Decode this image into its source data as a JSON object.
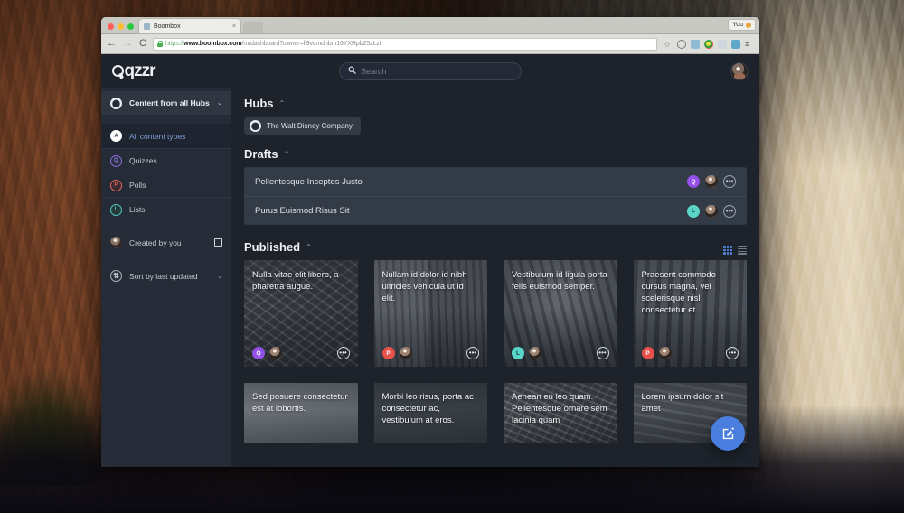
{
  "browser": {
    "tab_title": "Boombox",
    "tab_close": "×",
    "profile_label": "You",
    "url_scheme": "https://",
    "url_domain": "www.boombox.com",
    "url_path": "/m/dashboard?owner=fi9vcmdhbm16YXRpb25zLzI",
    "back_icon": "←",
    "forward_icon": "→",
    "reload_icon": "C",
    "star_icon": "☆",
    "menu_icon": "≡"
  },
  "app": {
    "logo": "qzzr",
    "search": {
      "placeholder": "Search",
      "value": ""
    }
  },
  "sidebar": {
    "header": {
      "label": "Content from all Hubs",
      "chevron": "⌄"
    },
    "items": [
      {
        "label": "All content types",
        "badge": "A",
        "badge_class": "all",
        "active": true
      },
      {
        "label": "Quizzes",
        "badge": "Q",
        "badge_class": "quiz",
        "active": false
      },
      {
        "label": "Polls",
        "badge": "P",
        "badge_class": "poll",
        "active": false
      },
      {
        "label": "Lists",
        "badge": "L",
        "badge_class": "list",
        "active": false
      }
    ],
    "created_by_you": {
      "label": "Created by you",
      "checked": false
    },
    "sort": {
      "label": "Sort by last updated",
      "chevron": "⌄",
      "icon": "⇅"
    }
  },
  "main": {
    "hubs": {
      "title": "Hubs",
      "caret": "⌃",
      "chip": {
        "label": "The Walt Disney Company",
        "icon": "⬤"
      }
    },
    "drafts": {
      "title": "Drafts",
      "caret": "⌃",
      "rows": [
        {
          "title": "Pellentesque Inceptos Justo",
          "type": "Q",
          "type_class": "quiz",
          "more": "•••"
        },
        {
          "title": "Purus Euismod Risus Sit",
          "type": "L",
          "type_class": "list",
          "more": "•••"
        }
      ]
    },
    "published": {
      "title": "Published",
      "caret": "⌃",
      "view_grid": "grid-view",
      "view_list": "list-view",
      "cards": [
        {
          "title": "Nulla vitae elit libero, a pharetra augue.",
          "type": "Q",
          "type_class": "quiz",
          "photo": "ph1",
          "more": "•••"
        },
        {
          "title": "Nullam id dolor id nibh ultricies vehicula ut id elit.",
          "type": "P",
          "type_class": "poll",
          "photo": "ph2",
          "more": "•••"
        },
        {
          "title": "Vestibulum id ligula porta felis euismod semper.",
          "type": "L",
          "type_class": "list",
          "photo": "ph3",
          "more": "•••"
        },
        {
          "title": "Praesent commodo cursus magna, vel scelerisque nisl consectetur et.",
          "type": "P",
          "type_class": "poll",
          "photo": "ph4",
          "more": "•••"
        }
      ],
      "cards_row2": [
        {
          "title": "Sed posuere consectetur est at lobortis.",
          "photo": "ph5"
        },
        {
          "title": "Morbi leo risus, porta ac consectetur ac, vestibulum at eros.",
          "photo": "ph6"
        },
        {
          "title": "Aenean eu leo quam. Pellentesque ornare sem lacinia quam",
          "photo": "ph7"
        },
        {
          "title": "Lorem ipsum dolor sit amet",
          "photo": "ph8"
        }
      ]
    },
    "fab": {
      "label": "create-content"
    }
  },
  "colors": {
    "accent": "#4a7fe0",
    "app_bg": "#1d222b",
    "sidebar_bg": "#262c37",
    "panel_bg": "#333b47",
    "quiz": "#9250e8",
    "poll": "#e8504a",
    "list": "#5ad6c8"
  }
}
